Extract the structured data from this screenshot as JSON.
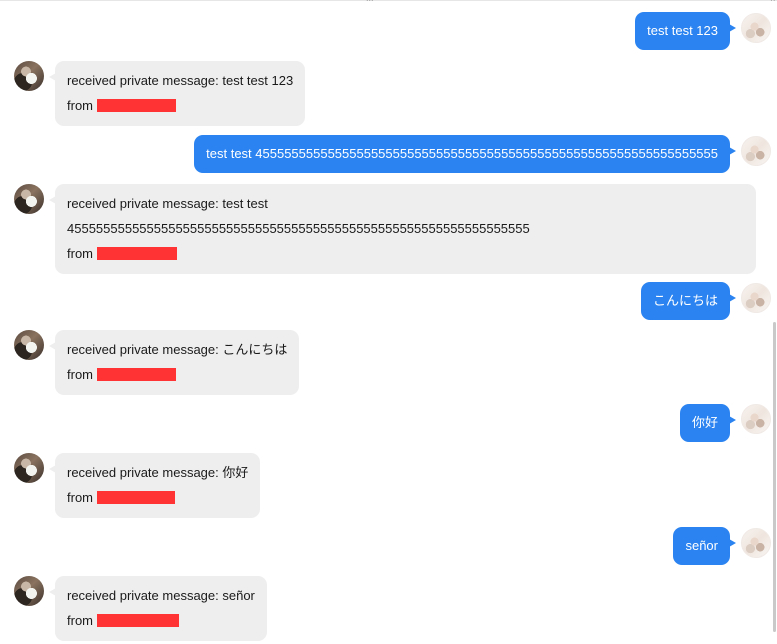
{
  "header": {
    "date_fragment": "...",
    "scroll_arrow": "⌃"
  },
  "colors": {
    "sent_bubble": "#2a83f0",
    "received_bubble": "#eeeeee",
    "redaction": "#ff3333"
  },
  "messages": [
    {
      "direction": "sent",
      "text": "test test 123"
    },
    {
      "direction": "received",
      "prefix": "received private message: ",
      "text": "test test 123",
      "from_label": "from"
    },
    {
      "direction": "sent",
      "text": "test test 4555555555555555555555555555555555555555555555555555555555555555"
    },
    {
      "direction": "received",
      "prefix": "received private message: ",
      "text_line1": "test test",
      "text_line2": "4555555555555555555555555555555555555555555555555555555555555555",
      "from_label": "from"
    },
    {
      "direction": "sent",
      "text": "こんにちは"
    },
    {
      "direction": "received",
      "prefix": "received private message: ",
      "text": "こんにちは",
      "from_label": "from"
    },
    {
      "direction": "sent",
      "text": "你好"
    },
    {
      "direction": "received",
      "prefix": "received private message: ",
      "text": "你好",
      "from_label": "from"
    },
    {
      "direction": "sent",
      "text": "señor"
    },
    {
      "direction": "received",
      "prefix": "received private message: ",
      "text": "señor",
      "from_label": "from"
    }
  ]
}
